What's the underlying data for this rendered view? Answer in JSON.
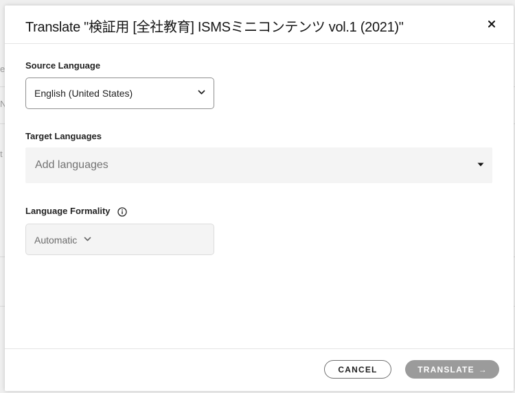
{
  "background": {
    "glyphs": [
      "e",
      "N",
      "t"
    ]
  },
  "dialog": {
    "title": "Translate \"検証用 [全社教育] ISMSミニコンテンツ vol.1 (2021)\"",
    "close_icon": "close-icon"
  },
  "source_language": {
    "label": "Source Language",
    "value": "English (United States)",
    "icon": "chevron-down-icon"
  },
  "target_languages": {
    "label": "Target Languages",
    "placeholder": "Add languages",
    "icon": "caret-down-icon"
  },
  "formality": {
    "label": "Language Formality",
    "info_icon": "info-icon",
    "value": "Automatic",
    "icon": "chevron-down-icon"
  },
  "footer": {
    "cancel_label": "CANCEL",
    "translate_label": "TRANSLATE",
    "translate_arrow": "→"
  },
  "colors": {
    "translate_button_disabled": "#9b9b9b",
    "input_bg": "#f4f4f4",
    "border": "#8f8f8f"
  }
}
